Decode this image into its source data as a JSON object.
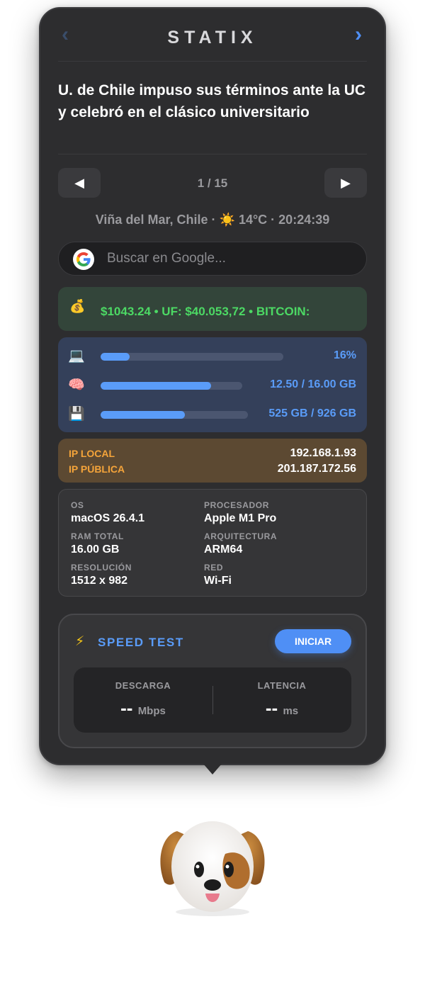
{
  "header": {
    "title": "STATIX",
    "prev_arrow": "‹",
    "next_arrow": "›"
  },
  "headline": "U. de Chile impuso sus términos ante la UC y celebró en el clásico universitario",
  "pager": {
    "prev_icon": "◀",
    "next_icon": "▶",
    "text": "1 / 15"
  },
  "meta": {
    "location": "Viña del Mar, Chile",
    "weather_icon": "☀️",
    "temperature": "14°C",
    "time": "20:24:39"
  },
  "search": {
    "icon": "google-logo",
    "placeholder": "Buscar en Google..."
  },
  "ticker": {
    "icon": "💰",
    "text": "$1043.24 • UF: $40.053,72 • BITCOIN:"
  },
  "resources": {
    "cpu": {
      "icon": "💻",
      "value": "16%",
      "fraction": 0.16
    },
    "ram": {
      "icon": "🧠",
      "value": "12.50 / 16.00 GB",
      "fraction": 0.78
    },
    "disk": {
      "icon": "💾",
      "value": "525 GB / 926 GB",
      "fraction": 0.57
    },
    "bar_color": "#5a9cf8"
  },
  "network": {
    "local_label": "IP LOCAL",
    "local_value": "192.168.1.93",
    "public_label": "IP PÚBLICA",
    "public_value": "201.187.172.56"
  },
  "system": {
    "os_label": "OS",
    "os_value": "macOS 26.4.1",
    "cpu_label": "PROCESADOR",
    "cpu_value": "Apple M1 Pro",
    "ram_label": "RAM TOTAL",
    "ram_value": "16.00 GB",
    "arch_label": "ARQUITECTURA",
    "arch_value": "ARM64",
    "res_label": "RESOLUCIÓN",
    "res_value": "1512 x 982",
    "net_label": "RED",
    "net_value": "Wi-Fi"
  },
  "speed_test": {
    "icon": "⚡",
    "title": "SPEED TEST",
    "button_label": "INICIAR",
    "download_label": "DESCARGA",
    "download_value": "--",
    "download_unit": "Mbps",
    "latency_label": "LATENCIA",
    "latency_value": "--",
    "latency_unit": "ms"
  },
  "mascot": {
    "icon": "dog-face-icon"
  },
  "colors": {
    "accent": "#4f8ff5",
    "ticker_text": "#4cd964",
    "ip_label": "#f5a43a"
  }
}
